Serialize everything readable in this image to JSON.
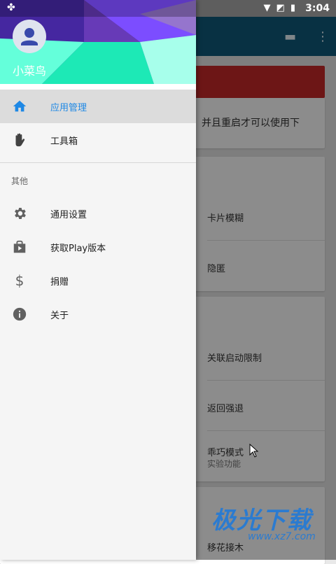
{
  "status_bar": {
    "time": "3:04"
  },
  "drawer": {
    "username": "小菜鸟",
    "items": [
      {
        "label": "应用管理",
        "icon": "home-icon",
        "active": true
      },
      {
        "label": "工具箱",
        "icon": "hand-icon",
        "active": false
      }
    ],
    "section_label": "其他",
    "other_items": [
      {
        "label": "通用设置",
        "icon": "gear-icon"
      },
      {
        "label": "获取Play版本",
        "icon": "play-store-icon"
      },
      {
        "label": "捐赠",
        "icon": "dollar-icon"
      },
      {
        "label": "关于",
        "icon": "info-icon"
      }
    ]
  },
  "background": {
    "notice_text": "并且重启才可以使用下",
    "card1": [
      "卡片模糊",
      "隐匿"
    ],
    "card2": [
      "关联启动限制",
      "返回强退",
      "乖巧模式"
    ],
    "card2_sub": "实验功能",
    "card3": [
      "移花接木"
    ]
  },
  "watermark": {
    "big": "极光下载",
    "small": "www.xz7.com"
  },
  "colors": {
    "accent": "#1e88e5",
    "toolbar": "#0f5a7a",
    "red_banner": "#c62828",
    "header_purple": "#5e35b1",
    "header_teal": "#64ffda"
  }
}
